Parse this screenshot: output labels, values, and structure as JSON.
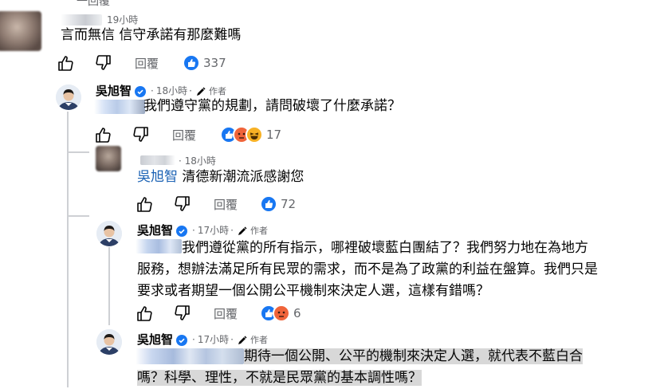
{
  "top_fragment": "一回覆",
  "comment1": {
    "time": "19小時",
    "text": "言而無信 信守承諾有那麼難嗎",
    "reply_label": "回覆",
    "react_count": "337"
  },
  "comment2": {
    "author": "吳旭智",
    "time": "18小時",
    "author_badge": "作者",
    "text": "我們遵守黨的規劃，請問破壞了什麼承諾？",
    "reply_label": "回覆",
    "react_count": "17"
  },
  "comment3": {
    "time": "18小時",
    "mention": "吳旭智",
    "text": " 清德新潮流派感謝您",
    "reply_label": "回覆",
    "react_count": "72"
  },
  "comment4": {
    "author": "吳旭智",
    "time": "17小時",
    "author_badge": "作者",
    "line1": " 我們遵從黨的所有指示，哪裡破壞藍白團結了？我們努力地在為地方",
    "line2": "服務，想辦法滿足所有民眾的需求，而不是為了政黨的利益在盤算。我們只是",
    "line3": "要求或者期望一個公開公平機制來決定人選，這樣有錯嗎？",
    "reply_label": "回覆",
    "react_count": "6"
  },
  "comment5": {
    "author": "吳旭智",
    "time": "17小時",
    "author_badge": "作者",
    "line1": "期待一個公開、公平的機制來決定人選，就代表不藍白合",
    "line2": "嗎？科學、理性，不就是民眾黨的基本調性嗎？"
  },
  "colors": {
    "like_blue": "#1877f2",
    "angry_orange": "#f0643a",
    "haha_yellow": "#f7b125",
    "verified_blue": "#1877f2",
    "mention_blue": "#1b62b4",
    "muted_text": "#65676b",
    "highlight_bg": "#d8d8d8"
  }
}
